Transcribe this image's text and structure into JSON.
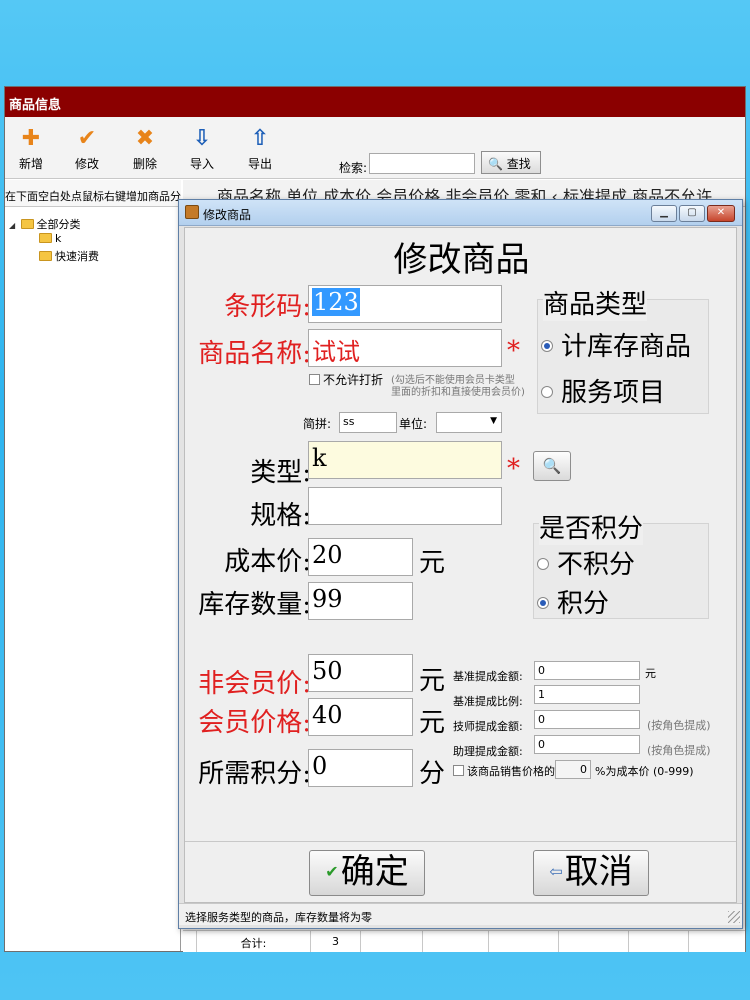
{
  "main_window": {
    "title": "商品信息",
    "toolbar": [
      {
        "label": "新增",
        "icon": "plus-icon",
        "glyph": "✚",
        "color": "#e8841a"
      },
      {
        "label": "修改",
        "icon": "checkmark-icon",
        "glyph": "✔",
        "color": "#e8841a"
      },
      {
        "label": "删除",
        "icon": "cross-icon",
        "glyph": "✖",
        "color": "#e8841a"
      },
      {
        "label": "导入",
        "icon": "import-icon",
        "glyph": "⇩",
        "color": "#1d5fb8"
      },
      {
        "label": "导出",
        "icon": "export-icon",
        "glyph": "⇧",
        "color": "#1d5fb8"
      }
    ],
    "search": {
      "label": "检索:",
      "value": "",
      "button_label": "查找",
      "button_icon": "magnifier-icon"
    },
    "left_panel": {
      "hint": "在下面空白处点鼠标右键增加商品分类",
      "tree": [
        {
          "label": "全部分类",
          "level": 0
        },
        {
          "label": "k",
          "level": 1
        },
        {
          "label": "快速消费",
          "level": 1
        }
      ]
    },
    "grid_header_text": "商品名称  单位 成本价 会员价格 非会员价 零和 ‹ 标准提成 商品不允许",
    "grid_footer": {
      "label": "合计:",
      "count": "3"
    }
  },
  "dialog": {
    "title": "修改商品",
    "heading": "修改商品",
    "controls": {
      "minimize": "▁",
      "maximize": "▢",
      "close": "✕"
    },
    "barcode": {
      "label": "条形码:",
      "value": "123"
    },
    "name": {
      "label": "商品名称:",
      "value": "试试"
    },
    "required_mark": "*",
    "no_discount": {
      "label": "不允许打折",
      "checked": false,
      "hint_line1": "(勾选后不能使用会员卡类型",
      "hint_line2": "里面的折扣和直接使用会员价)"
    },
    "jianpin": {
      "label": "简拼:",
      "value": "ss"
    },
    "unit_select": {
      "label": "单位:",
      "value": ""
    },
    "category": {
      "label": "类型:",
      "value": "k"
    },
    "spec": {
      "label": "规格:",
      "value": ""
    },
    "cost": {
      "label": "成本价:",
      "value": "20",
      "unit": "元"
    },
    "stock": {
      "label": "库存数量:",
      "value": "99"
    },
    "nonmember_price": {
      "label": "非会员价:",
      "value": "50",
      "unit": "元"
    },
    "member_price": {
      "label": "会员价格:",
      "value": "40",
      "unit": "元"
    },
    "points_needed": {
      "label": "所需积分:",
      "value": "0",
      "unit": "分"
    },
    "product_type": {
      "title": "商品类型",
      "options": [
        {
          "label": "计库存商品",
          "selected": true
        },
        {
          "label": "服务项目",
          "selected": false
        }
      ]
    },
    "points_group": {
      "title": "是否积分",
      "options": [
        {
          "label": "不积分",
          "selected": false
        },
        {
          "label": "积分",
          "selected": true
        }
      ]
    },
    "commission": {
      "base_amount": {
        "label": "基准提成金额:",
        "value": "0",
        "unit": "元"
      },
      "base_ratio": {
        "label": "基准提成比例:",
        "value": "1"
      },
      "tech_amount": {
        "label": "技师提成金额:",
        "value": "0",
        "note": "(按角色提成)"
      },
      "assistant_amount": {
        "label": "助理提成金额:",
        "value": "0",
        "note": "(按角色提成)"
      },
      "cost_ratio": {
        "prefix": "该商品销售价格的",
        "value": "0",
        "suffix": "%为成本价 (0-999)",
        "checked": false
      }
    },
    "confirm_label": "确定",
    "cancel_label": "取消",
    "status": "选择服务类型的商品，库存数量将为零",
    "colors": {
      "title_bar": "#8b0000",
      "label_red": "#e02020",
      "category_field_bg": "#fdfbdf",
      "selection": "#3399ff"
    }
  }
}
